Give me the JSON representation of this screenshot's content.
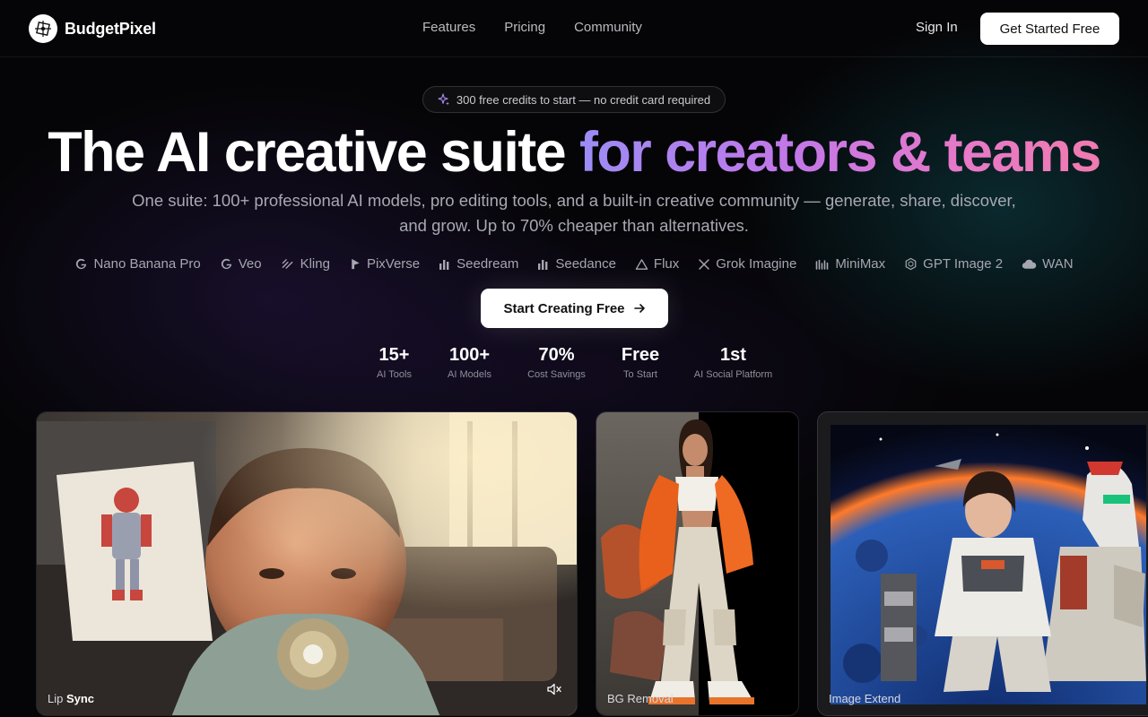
{
  "nav": {
    "brand": "BudgetPixel",
    "links": [
      "Features",
      "Pricing",
      "Community"
    ],
    "sign_in": "Sign In",
    "cta": "Get Started Free"
  },
  "hero": {
    "badge": "300 free credits to start — no credit card required",
    "headline_plain": "The AI creative suite ",
    "headline_gradient": "for creators & teams",
    "subtitle": "One suite: 100+ professional AI models, pro editing tools, and a built-in creative community — generate, share, discover, and grow. Up to 70% cheaper than alternatives.",
    "cta": "Start Creating Free"
  },
  "models": [
    {
      "icon": "google-icon",
      "label": "Nano Banana Pro"
    },
    {
      "icon": "google-icon",
      "label": "Veo"
    },
    {
      "icon": "kling-icon",
      "label": "Kling"
    },
    {
      "icon": "pixverse-icon",
      "label": "PixVerse"
    },
    {
      "icon": "bars-icon",
      "label": "Seedream"
    },
    {
      "icon": "bars-icon",
      "label": "Seedance"
    },
    {
      "icon": "triangle-icon",
      "label": "Flux"
    },
    {
      "icon": "x-icon",
      "label": "Grok Imagine"
    },
    {
      "icon": "minimax-icon",
      "label": "MiniMax"
    },
    {
      "icon": "hexagon-icon",
      "label": "GPT Image 2"
    },
    {
      "icon": "cloud-icon",
      "label": "WAN"
    }
  ],
  "stats": [
    {
      "value": "15+",
      "label": "AI Tools"
    },
    {
      "value": "100+",
      "label": "AI Models"
    },
    {
      "value": "70%",
      "label": "Cost Savings"
    },
    {
      "value": "Free",
      "label": "To Start"
    },
    {
      "value": "1st",
      "label": "AI Social Platform"
    }
  ],
  "cards": [
    {
      "label_a": "Lip ",
      "label_b": "Sync"
    },
    {
      "label_a": "BG Removal",
      "label_b": ""
    },
    {
      "label_a": "Image Extend",
      "label_b": ""
    }
  ],
  "colors": {
    "accent_gradient": [
      "#9c8cf4",
      "#c277e8",
      "#e879c6",
      "#f07ab0"
    ],
    "background": "#050507"
  }
}
